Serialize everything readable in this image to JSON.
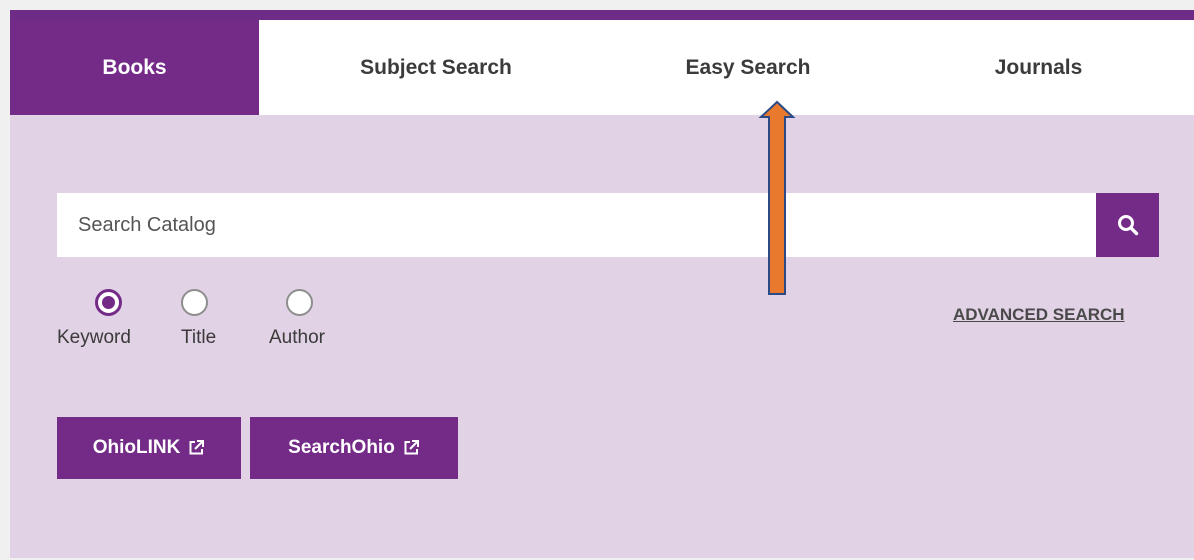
{
  "tabs": [
    {
      "label": "Books",
      "active": true
    },
    {
      "label": "Subject Search",
      "active": false
    },
    {
      "label": "Easy Search",
      "active": false
    },
    {
      "label": "Journals",
      "active": false
    }
  ],
  "search": {
    "placeholder": "Search Catalog",
    "value": "",
    "button_icon": "search-icon"
  },
  "search_type": {
    "options": [
      {
        "label": "Keyword",
        "checked": true
      },
      {
        "label": "Title",
        "checked": false
      },
      {
        "label": "Author",
        "checked": false
      }
    ]
  },
  "advanced_search": {
    "label": "ADVANCED SEARCH"
  },
  "external_links": [
    {
      "label": "OhioLINK",
      "icon": "external-link-icon"
    },
    {
      "label": "SearchOhio",
      "icon": "external-link-icon"
    }
  ],
  "colors": {
    "brand_purple": "#742b88",
    "panel_background": "#e1d2e5",
    "annotation_arrow": "#e8792d"
  }
}
